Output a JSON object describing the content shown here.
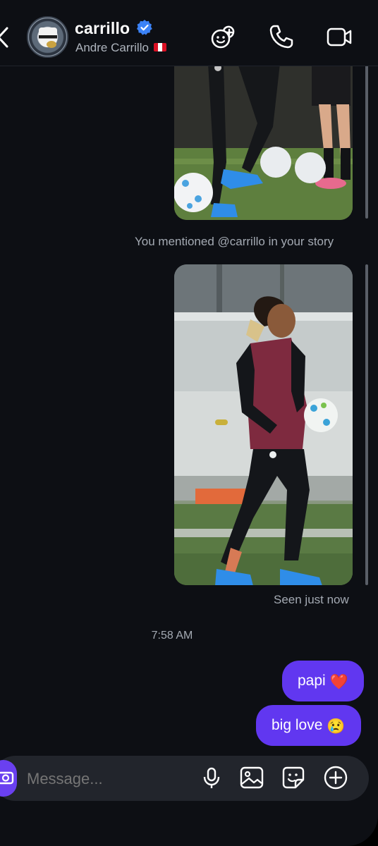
{
  "header": {
    "username": "carrillo",
    "full_name": "Andre Carrillo",
    "icons": [
      "back-chevron",
      "verified-badge",
      "add-to-group-icon",
      "phone-icon",
      "video-icon"
    ]
  },
  "thread": {
    "story_mention_caption": "You mentioned @carrillo in your story",
    "seen_status": "Seen just now",
    "time_separator": "7:58 AM",
    "messages": [
      {
        "text": "papi",
        "emoji": "❤️"
      },
      {
        "text": "big love",
        "emoji": "😢"
      }
    ]
  },
  "composer": {
    "placeholder": "Message...",
    "icons": [
      "camera-icon",
      "microphone-icon",
      "gallery-icon",
      "sticker-icon",
      "plus-icon"
    ]
  },
  "colors": {
    "background": "#0d0f14",
    "bubble": "#6137f0",
    "verified": "#3b82f6"
  }
}
